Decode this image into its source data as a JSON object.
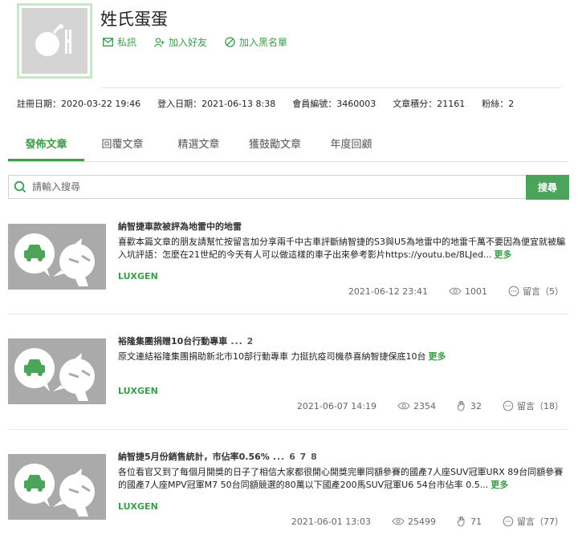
{
  "profile": {
    "username": "姓氏蛋蛋",
    "actions": [
      "私訊",
      "加入好友",
      "加入黑名單"
    ],
    "stats": [
      "註冊日期：2020-03-22 19:46",
      "登入日期：2021-06-13 8:38",
      "會員編號：3460003",
      "文章積分：21161",
      "粉絲：2"
    ]
  },
  "tabs": [
    "發佈文章",
    "回覆文章",
    "精選文章",
    "獲鼓勵文章",
    "年度回顧"
  ],
  "search": {
    "placeholder": "請輸入搜尋",
    "button": "搜尋"
  },
  "articles": [
    {
      "title": "納智捷車款被評為地雷中的地雷",
      "pages": "",
      "excerpt": "喜歡本篇文章的朋友請幫忙按留言加分享兩千中古車評斷納智捷的S3與U5為地雷中的地雷千萬不要因為便宜就被騙入坑評語：怎麼在21世紀的今天有人可以做這樣的車子出來參考影片https://youtu.be/8LJed...",
      "more": "更多",
      "category": "LUXGEN",
      "date": "2021-06-12 23:41",
      "views": "1001",
      "likes": "",
      "comments": "留言（5）"
    },
    {
      "title": "裕隆集團捐贈10台行動專車",
      "pages": "... 2",
      "excerpt": "原文連結裕隆集團捐助新北市10部行動專車 力挺抗疫司機恭喜納智捷保底10台",
      "more": "更多",
      "category": "LUXGEN",
      "date": "2021-06-07 14:19",
      "views": "2354",
      "likes": "32",
      "comments": "留言（18）"
    },
    {
      "title": "納智捷5月份銷售統計，市佔率0.56%",
      "pages": "... 6 7 8",
      "excerpt": "各位看官又到了每個月開獎的日子了相信大家都很開心開獎完畢同額參賽的國產7人座SUV冠軍URX 89台同額參賽的國產7人座MPV冠軍M7 50台同額競選的80萬以下國產200馬SUV冠軍U6 54台市佔率 0.5...",
      "more": "更多",
      "category": "LUXGEN",
      "date": "2021-06-01 13:03",
      "views": "25499",
      "likes": "71",
      "comments": "留言（77）"
    }
  ],
  "colors": {
    "accent": "#3a9d4a",
    "button": "#4ca35a",
    "thumb": "#aaaaaa"
  }
}
